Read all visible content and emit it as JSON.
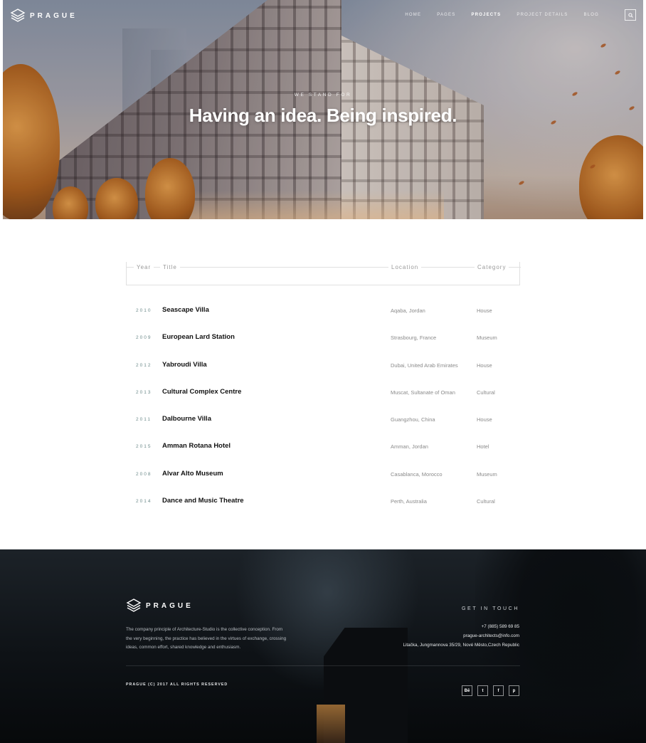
{
  "brand": {
    "name": "PRAGUE"
  },
  "nav": {
    "items": [
      {
        "label": "HOME",
        "active": false
      },
      {
        "label": "PAGES",
        "active": false
      },
      {
        "label": "PROJECTS",
        "active": true
      },
      {
        "label": "PROJECT DETAILS",
        "active": false
      },
      {
        "label": "BLOG",
        "active": false
      }
    ],
    "search_icon": "search-icon"
  },
  "hero": {
    "kicker": "WE STAND FOR",
    "headline": "Having an idea. Being inspired."
  },
  "table": {
    "headers": {
      "year": "Year",
      "title": "Title",
      "location": "Location",
      "category": "Category"
    },
    "rows": [
      {
        "year": "2010",
        "title": "Seascape Villa",
        "location": "Aqaba, Jordan",
        "category": "House"
      },
      {
        "year": "2009",
        "title": "European Lard Station",
        "location": "Strasbourg, France",
        "category": "Museum"
      },
      {
        "year": "2012",
        "title": "Yabroudi Villa",
        "location": "Dubai, United Arab Emirates",
        "category": "House"
      },
      {
        "year": "2013",
        "title": "Cultural Complex Centre",
        "location": "Muscat, Sultanate of Oman",
        "category": "Cultural"
      },
      {
        "year": "2011",
        "title": "Dalbourne Villa",
        "location": "Guangzhou, China",
        "category": "House"
      },
      {
        "year": "2015",
        "title": "Amman Rotana Hotel",
        "location": "Amman, Jordan",
        "category": "Hotel"
      },
      {
        "year": "2008",
        "title": "Alvar Alto Museum",
        "location": "Casablanca, Morocco",
        "category": "Museum"
      },
      {
        "year": "2014",
        "title": "Dance and Music Theatre",
        "location": "Perth, Australia",
        "category": "Cultural"
      }
    ]
  },
  "footer": {
    "about": "The company principle of Architecture-Studio is the collective conception. From the very beginning, the practice has believed in the virtues of exchange, crossing ideas, common effort, shared knowledge and enthusiasm.",
    "contact_title": "GET IN TOUCH",
    "phone": "+7 (885) 589 69 85",
    "email": "prague-architects@info.com",
    "address": "Litačka, Jungmannova 35/29, Nové Město,Czech Republic",
    "copyright": "PRAGUE (C) 2017 ALL RIGHTS RESERVED",
    "social": [
      {
        "label": "Bē",
        "icon": "behance-icon"
      },
      {
        "label": "t",
        "icon": "twitter-icon"
      },
      {
        "label": "f",
        "icon": "facebook-icon"
      },
      {
        "label": "p",
        "icon": "pinterest-icon"
      }
    ]
  }
}
